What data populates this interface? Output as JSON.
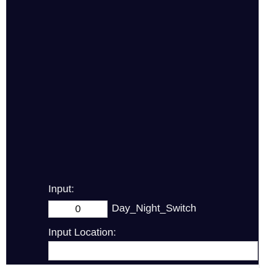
{
  "form": {
    "input_label": "Input:",
    "input_value": "0",
    "input_name": "Day_Night_Switch",
    "location_label": "Input Location:",
    "location_value": ""
  }
}
